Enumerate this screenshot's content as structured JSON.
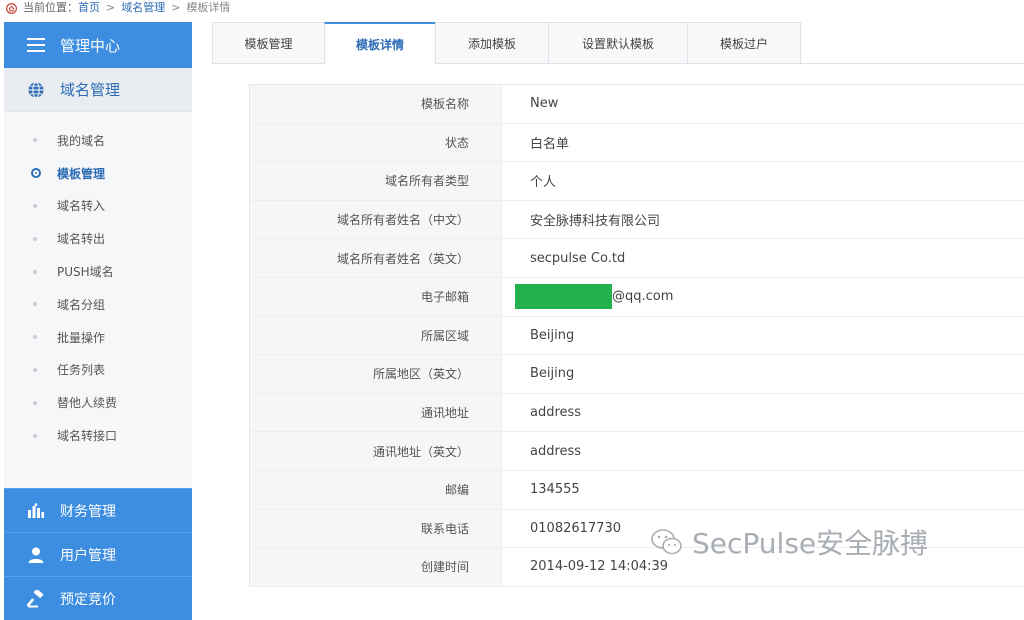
{
  "breadcrumb": {
    "prefix": "当前位置：",
    "items": [
      "首页",
      "域名管理"
    ],
    "separator": ">",
    "current": "模板详情"
  },
  "sidebar": {
    "header": "管理中心",
    "section": "域名管理",
    "items": [
      {
        "label": "我的域名",
        "active": false
      },
      {
        "label": "模板管理",
        "active": true
      },
      {
        "label": "域名转入",
        "active": false
      },
      {
        "label": "域名转出",
        "active": false
      },
      {
        "label": "PUSH域名",
        "active": false
      },
      {
        "label": "域名分组",
        "active": false
      },
      {
        "label": "批量操作",
        "active": false
      },
      {
        "label": "任务列表",
        "active": false
      },
      {
        "label": "替他人续费",
        "active": false
      },
      {
        "label": "域名转接口",
        "active": false
      }
    ],
    "bottom": [
      "财务管理",
      "用户管理",
      "预定竞价"
    ]
  },
  "tabs": [
    {
      "label": "模板管理",
      "active": false
    },
    {
      "label": "模板详情",
      "active": true
    },
    {
      "label": "添加模板",
      "active": false
    },
    {
      "label": "设置默认模板",
      "active": false
    },
    {
      "label": "模板过户",
      "active": false
    }
  ],
  "detail": [
    {
      "label": "模板名称",
      "value": "New"
    },
    {
      "label": "状态",
      "value": "白名单"
    },
    {
      "label": "域名所有者类型",
      "value": "个人"
    },
    {
      "label": "域名所有者姓名（中文）",
      "value": "安全脉搏科技有限公司"
    },
    {
      "label": "域名所有者姓名（英文）",
      "value": "secpulse Co.td"
    },
    {
      "label": "电子邮箱",
      "value": "@qq.com"
    },
    {
      "label": "所属区域",
      "value": "Beijing"
    },
    {
      "label": "所属地区（英文）",
      "value": "Beijing"
    },
    {
      "label": "通讯地址",
      "value": "address"
    },
    {
      "label": "通讯地址（英文）",
      "value": "address"
    },
    {
      "label": "邮编",
      "value": "134555"
    },
    {
      "label": "联系电话",
      "value": "01082617730"
    },
    {
      "label": "创建时间",
      "value": "2014-09-12 14:04:39"
    }
  ],
  "watermark": "SecPulse安全脉搏",
  "colors": {
    "accent": "#3d8ee0",
    "link": "#2b6cb5",
    "redaction": "#22b14c"
  }
}
